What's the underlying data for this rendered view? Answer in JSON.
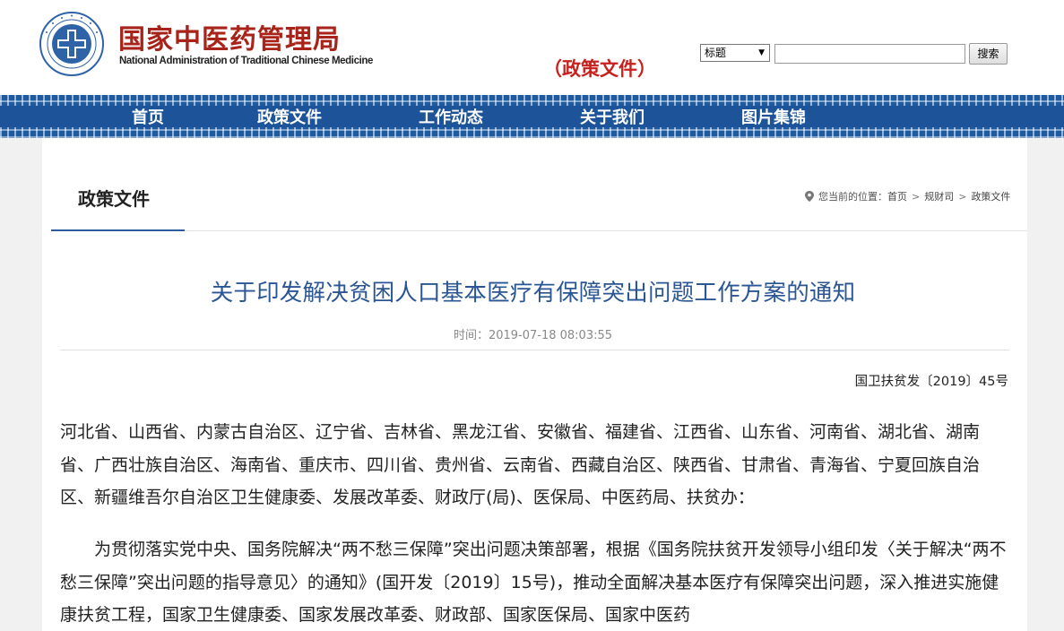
{
  "header": {
    "site_name_cn": "国家中医药管理局",
    "site_name_en": "National Administration of Traditional Chinese Medicine",
    "section_tag": "（政策文件）",
    "emblem_icon": "tcm-emblem-icon"
  },
  "search": {
    "field_select": "标题",
    "input_value": "",
    "button_label": "搜索"
  },
  "nav": {
    "items": [
      {
        "label": "首页"
      },
      {
        "label": "政策文件"
      },
      {
        "label": "工作动态"
      },
      {
        "label": "关于我们"
      },
      {
        "label": "图片集锦"
      }
    ]
  },
  "panel": {
    "title": "政策文件",
    "breadcrumb": {
      "prefix": "您当前的位置：",
      "items": [
        "首页",
        "规财司",
        "政策文件"
      ],
      "separator": ">"
    }
  },
  "article": {
    "title": "关于印发解决贫困人口基本医疗有保障突出问题工作方案的通知",
    "meta": "时间：2019-07-18 08:03:55",
    "doc_number": "国卫扶贫发〔2019〕45号",
    "paragraphs": [
      "河北省、山西省、内蒙古自治区、辽宁省、吉林省、黑龙江省、安徽省、福建省、江西省、山东省、河南省、湖北省、湖南省、广西壮族自治区、海南省、重庆市、四川省、贵州省、云南省、西藏自治区、陕西省、甘肃省、青海省、宁夏回族自治区、新疆维吾尔自治区卫生健康委、发展改革委、财政厅(局)、医保局、中医药局、扶贫办：",
      "为贯彻落实党中央、国务院解决“两不愁三保障”突出问题决策部署，根据《国务院扶贫开发领导小组印发〈关于解决“两不愁三保障”突出问题的指导意见〉的通知》(国开发〔2019〕15号)，推动全面解决基本医疗有保障突出问题，深入推进实施健康扶贫工程，国家卫生健康委、国家发展改革委、财政部、国家医保局、国家中医药"
    ]
  },
  "colors": {
    "brand_red": "#a8231a",
    "nav_blue": "#1e5aa0",
    "title_blue": "#2b5694",
    "section_red": "#c8201c"
  }
}
